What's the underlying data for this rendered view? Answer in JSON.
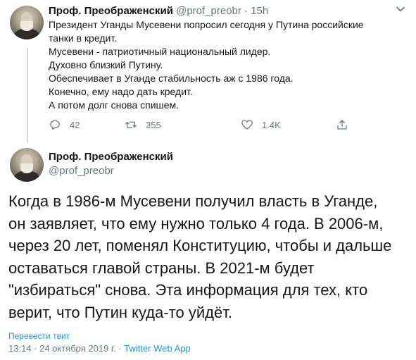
{
  "tweet1": {
    "author_name": "Проф. Преображенский",
    "handle": "@prof_preobr",
    "separator": "·",
    "time": "15h",
    "lines": [
      "Президент Уганды Мусевени попросил сегодня у Путина российские",
      "танки в кредит.",
      "Мусевени - патриотичный национальный лидер.",
      "Духовно близкий Путину.",
      "Обеспечивает в Уганде стабильность аж с 1986 года.",
      "Конечно, ему надо дать кредит.",
      "А потом долг снова спишем."
    ],
    "actions": {
      "replies": "42",
      "retweets": "355",
      "likes": "1.4K"
    }
  },
  "tweet2": {
    "author_name": "Проф. Преображенский",
    "handle": "@prof_preobr",
    "lines": [
      "Когда в 1986-м Мусевени получил власть в Уганде,",
      "он заявляет, что ему нужно только 4 года. В 2006-м,",
      "через 20 лет, поменял Конституцию, чтобы и дальше",
      "оставаться главой страны. В 2021-м будет",
      "\"избираться\" снова. Эта информация для тех, кто",
      "верит, что Путин куда-то уйдёт."
    ],
    "translate_label": "Перевести твит",
    "timestamp": "13:14 · 24 октября 2019 г.",
    "separator": "·",
    "source": "Twitter Web App"
  },
  "colors": {
    "text": "#14171a",
    "muted": "#657786",
    "link": "#1b95e0",
    "thread_line": "#ccd6dd"
  }
}
